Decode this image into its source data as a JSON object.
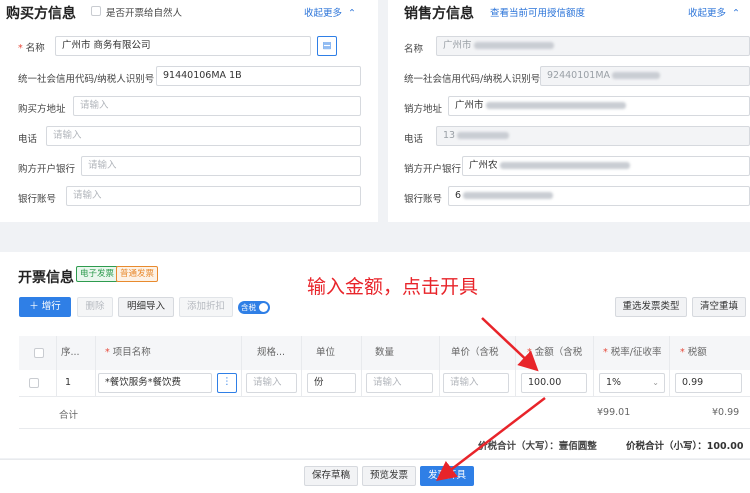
{
  "buyer": {
    "title": "购买方信息",
    "natural_person_label": "是否开票给自然人",
    "collapse_label": "收起更多",
    "fields": {
      "name": {
        "label": "名称",
        "value": "广州市  商务有限公司"
      },
      "tax_id": {
        "label": "统一社会信用代码/纳税人识别号",
        "value": "91440106MA        1B"
      },
      "address": {
        "label": "购买方地址",
        "placeholder": "请输入"
      },
      "phone": {
        "label": "电话",
        "placeholder": "请输入"
      },
      "bank": {
        "label": "购方开户银行",
        "placeholder": "请输入"
      },
      "account": {
        "label": "银行账号",
        "placeholder": "请输入"
      }
    }
  },
  "seller": {
    "title": "销售方信息",
    "credit_link": "查看当前可用授信额度",
    "collapse_label": "收起更多",
    "fields": {
      "name": {
        "label": "名称",
        "value": "广州市"
      },
      "tax_id": {
        "label": "统一社会信用代码/纳税人识别号",
        "value": "92440101MA"
      },
      "address": {
        "label": "销方地址",
        "value": "广州市"
      },
      "phone": {
        "label": "电话",
        "value": "13"
      },
      "bank": {
        "label": "销方开户银行",
        "value": "广州农"
      },
      "account": {
        "label": "银行账号",
        "value": "6"
      }
    }
  },
  "invoice": {
    "title": "开票信息",
    "tag_electronic": "电子发票",
    "tag_normal": "普通发票",
    "buttons": {
      "add_row": "＋ 增行",
      "delete": "删除",
      "import_detail": "明细导入",
      "add_discount": "添加折扣",
      "tax_inclusive": "含税",
      "reselect_type": "重选发票类型",
      "clear": "清空重填"
    },
    "annotation": "输入金额，点击开具",
    "columns": [
      "序...",
      "项目名称",
      "规格...",
      "单位",
      "数量",
      "单价（含税",
      "金额（含税",
      "税率/征收率",
      "税额"
    ],
    "row": {
      "index": "1",
      "item_name": "*餐饮服务*餐饮费",
      "spec_placeholder": "请输入",
      "unit": "份",
      "qty_placeholder": "请输入",
      "price_placeholder": "请输入",
      "amount": "100.00",
      "tax_rate": "1%",
      "tax": "0.99"
    },
    "total": {
      "label": "合计",
      "amount": "¥99.01",
      "tax": "¥0.99",
      "upper_label": "价税合计（大写）：",
      "upper_value": "壹佰圆整",
      "lower_label": "价税合计（小写）：",
      "lower_value": "100.00"
    }
  },
  "footer": {
    "save_draft": "保存草稿",
    "preview": "预览发票",
    "issue": "发票开具"
  },
  "colors": {
    "primary": "#2f7fe6",
    "annotation": "#e8242a",
    "tag_green": "#2e9b4e",
    "tag_orange": "#e88a2e"
  }
}
